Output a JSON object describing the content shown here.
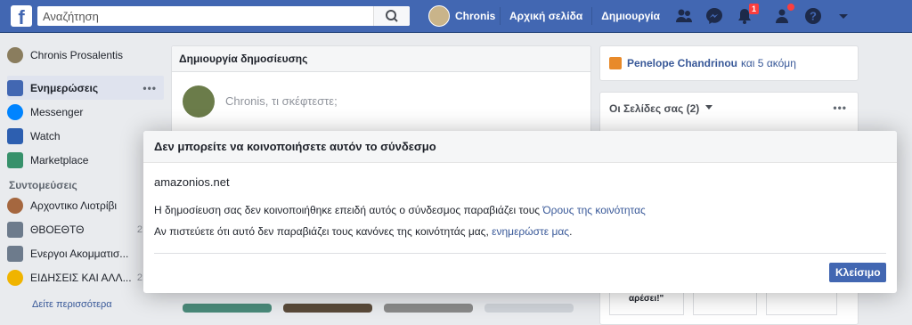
{
  "topbar": {
    "logo": "f",
    "search_placeholder": "Αναζήτηση",
    "user_name": "Chronis",
    "nav_home": "Αρχική σελίδα",
    "nav_create": "Δημιουργία",
    "notification_count": "1",
    "brand_color": "#4267b2"
  },
  "sidebar": {
    "profile_name": "Chronis Prosalentis",
    "items": [
      {
        "label": "Ενημερώσεις",
        "icon": "news-feed-icon",
        "active": true
      },
      {
        "label": "Messenger",
        "icon": "messenger-icon"
      },
      {
        "label": "Watch",
        "icon": "watch-icon"
      },
      {
        "label": "Marketplace",
        "icon": "marketplace-icon"
      }
    ],
    "more_dots": "•••",
    "shortcuts_title": "Συντομεύσεις",
    "shortcuts": [
      {
        "label": "Αρχοντικο Λιοτρίβι",
        "count": ""
      },
      {
        "label": "ΘΒΟΕΘΤΘ",
        "count": "2"
      },
      {
        "label": "Ενεργοι Ακομματισ...",
        "count": ""
      },
      {
        "label": "ΕΙΔΗΣΕΙΣ ΚΑΙ ΑΛΛ...",
        "count": "2"
      }
    ],
    "see_more": "Δείτε περισσότερα"
  },
  "composer": {
    "title": "Δημιουργία δημοσίευσης",
    "placeholder": "Chronis, τι σκέφτεστε;"
  },
  "right": {
    "birthday_name": "Penelope Chandrinou",
    "birthday_rest": "και 5 ακόμη",
    "pages_title": "Οι Σελίδες σας (2)",
    "pages_dots": "•••",
    "tile_text": "αρέσει!\""
  },
  "modal": {
    "title": "Δεν μπορείτε να κοινοποιήσετε αυτόν το σύνδεσμο",
    "domain": "amazonios.net",
    "line1_text": "Η δημοσίευση σας δεν κοινοποιήθηκε επειδή αυτός ο σύνδεσμος παραβιάζει τους ",
    "line1_link": "Όρους της κοινότητας",
    "line2_text": "Αν πιστεύετε ότι αυτό δεν παραβιάζει τους κανόνες της κοινότητάς μας, ",
    "line2_link": "ενημερώστε μας",
    "line2_end": ".",
    "close_label": "Κλείσιμο"
  }
}
